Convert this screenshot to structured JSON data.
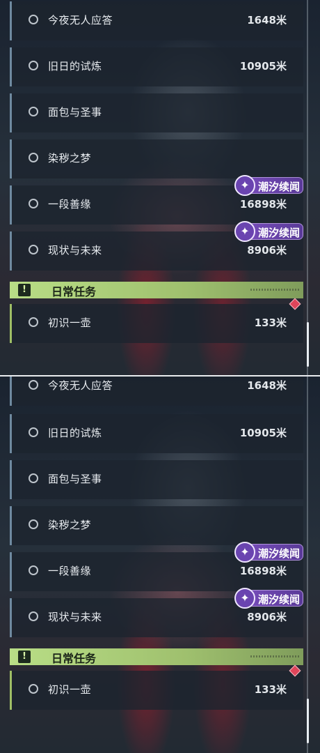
{
  "panels": [
    {
      "quests": [
        {
          "name": "今夜无人应答",
          "distance": "1648米"
        },
        {
          "name": "旧日的试炼",
          "distance": "10905米"
        },
        {
          "name": "面包与圣事",
          "distance": ""
        },
        {
          "name": "染秽之梦",
          "distance": ""
        },
        {
          "name": "一段善缘",
          "distance": "16898米",
          "badge": "潮汐续闻"
        },
        {
          "name": "现状与未来",
          "distance": "8906米",
          "badge": "潮汐续闻"
        }
      ],
      "daily_section": {
        "title": "日常任务",
        "icon": "!"
      },
      "daily_quests": [
        {
          "name": "初识一壶",
          "distance": "133米"
        }
      ]
    },
    {
      "quests": [
        {
          "name": "今夜无人应答",
          "distance": "1648米"
        },
        {
          "name": "旧日的试炼",
          "distance": "10905米"
        },
        {
          "name": "面包与圣事",
          "distance": ""
        },
        {
          "name": "染秽之梦",
          "distance": ""
        },
        {
          "name": "一段善缘",
          "distance": "16898米",
          "badge": "潮汐续闻"
        },
        {
          "name": "现状与未来",
          "distance": "8906米",
          "badge": "潮汐续闻"
        }
      ],
      "daily_section": {
        "title": "日常任务",
        "icon": "!"
      },
      "daily_quests": [
        {
          "name": "初识一壶",
          "distance": "133米"
        }
      ]
    }
  ],
  "colors": {
    "accent_daily": "#b9de86",
    "badge_purple": "#7b4fbf",
    "marker_red": "#e0455a"
  },
  "icons": {
    "badge_icon": "✦",
    "radio": "radio-circle-icon"
  }
}
